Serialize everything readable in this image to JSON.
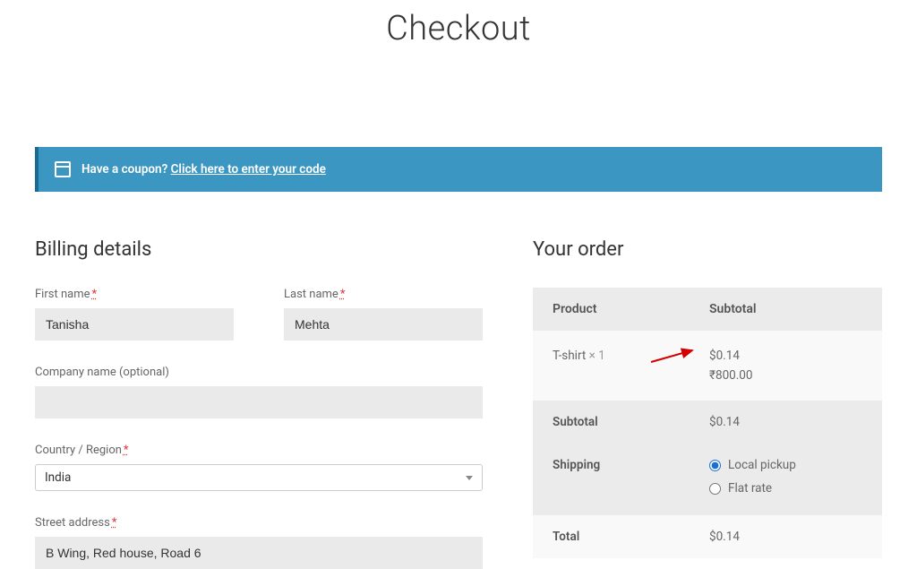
{
  "page": {
    "title": "Checkout"
  },
  "coupon": {
    "prompt": "Have a coupon? ",
    "link": "Click here to enter your code"
  },
  "billing": {
    "heading": "Billing details",
    "first_name_label": "First name",
    "first_name_value": "Tanisha",
    "last_name_label": "Last name",
    "last_name_value": "Mehta",
    "company_label": "Company name (optional)",
    "company_value": "",
    "country_label": "Country / Region",
    "country_value": "India",
    "street_label": "Street address",
    "street_value": "B Wing, Red house, Road 6"
  },
  "order": {
    "heading": "Your order",
    "col_product": "Product",
    "col_subtotal": "Subtotal",
    "item_name": "T-shirt",
    "item_qty": "× 1",
    "item_price": "$0.14",
    "item_price_alt": "₹800.00",
    "subtotal_label": "Subtotal",
    "subtotal_value": "$0.14",
    "shipping_label": "Shipping",
    "shipping_options": {
      "local": "Local pickup",
      "flat": "Flat rate"
    },
    "total_label": "Total",
    "total_value": "$0.14"
  }
}
